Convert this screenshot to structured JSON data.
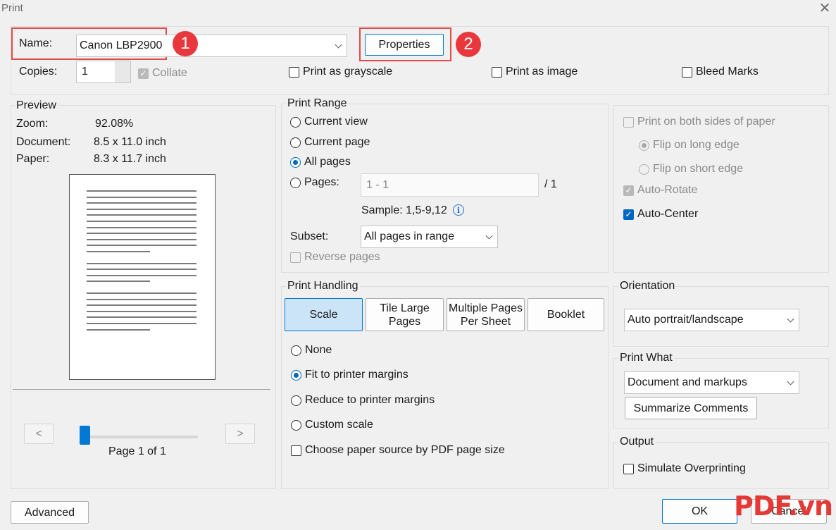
{
  "window": {
    "title": "Print"
  },
  "printer": {
    "name_label": "Name:",
    "name_value": "Canon LBP2900",
    "properties_label": "Properties",
    "copies_label": "Copies:",
    "copies_value": "1",
    "collate_label": "Collate",
    "grayscale_label": "Print as grayscale",
    "image_label": "Print as image",
    "bleed_label": "Bleed Marks"
  },
  "annotations": {
    "badge1": "1",
    "badge2": "2"
  },
  "preview": {
    "legend": "Preview",
    "zoom_label": "Zoom:",
    "zoom_value": "92.08%",
    "document_label": "Document:",
    "document_value": "8.5 x 11.0 inch",
    "paper_label": "Paper:",
    "paper_value": "8.3 x 11.7 inch",
    "prev_label": "<",
    "next_label": ">",
    "page_label": "Page 1 of 1",
    "slider_position": 0
  },
  "print_range": {
    "legend": "Print Range",
    "current_view": "Current view",
    "current_page": "Current page",
    "all_pages": "All pages",
    "pages_label": "Pages:",
    "pages_value": "1 - 1",
    "pages_total": "/ 1",
    "sample": "Sample: 1,5-9,12",
    "subset_label": "Subset:",
    "subset_value": "All pages in range",
    "reverse_label": "Reverse pages",
    "selected": "All pages"
  },
  "duplex": {
    "both_sides": "Print on both sides of paper",
    "flip_long": "Flip on long edge",
    "flip_short": "Flip on short edge",
    "auto_rotate": "Auto-Rotate",
    "auto_center": "Auto-Center"
  },
  "handling": {
    "legend": "Print Handling",
    "tabs": [
      "Scale",
      "Tile Large\nPages",
      "Multiple Pages\nPer Sheet",
      "Booklet"
    ],
    "selected_tab": "Scale",
    "none": "None",
    "fit": "Fit to printer margins",
    "reduce": "Reduce to printer margins",
    "custom": "Custom scale",
    "paper_source": "Choose paper source by PDF page size",
    "selected": "Fit to printer margins"
  },
  "orientation": {
    "legend": "Orientation",
    "value": "Auto portrait/landscape"
  },
  "print_what": {
    "legend": "Print What",
    "value": "Document and markups",
    "summarize_label": "Summarize Comments"
  },
  "output": {
    "legend": "Output",
    "simulate_label": "Simulate Overprinting"
  },
  "footer": {
    "advanced_label": "Advanced",
    "ok_label": "OK",
    "cancel_label": "Cancel"
  },
  "watermark": {
    "text": "PDF.vn"
  },
  "colors": {
    "accent": "#0067c0",
    "annotation_red": "#e04b4b",
    "watermark_red": "#e53935"
  }
}
